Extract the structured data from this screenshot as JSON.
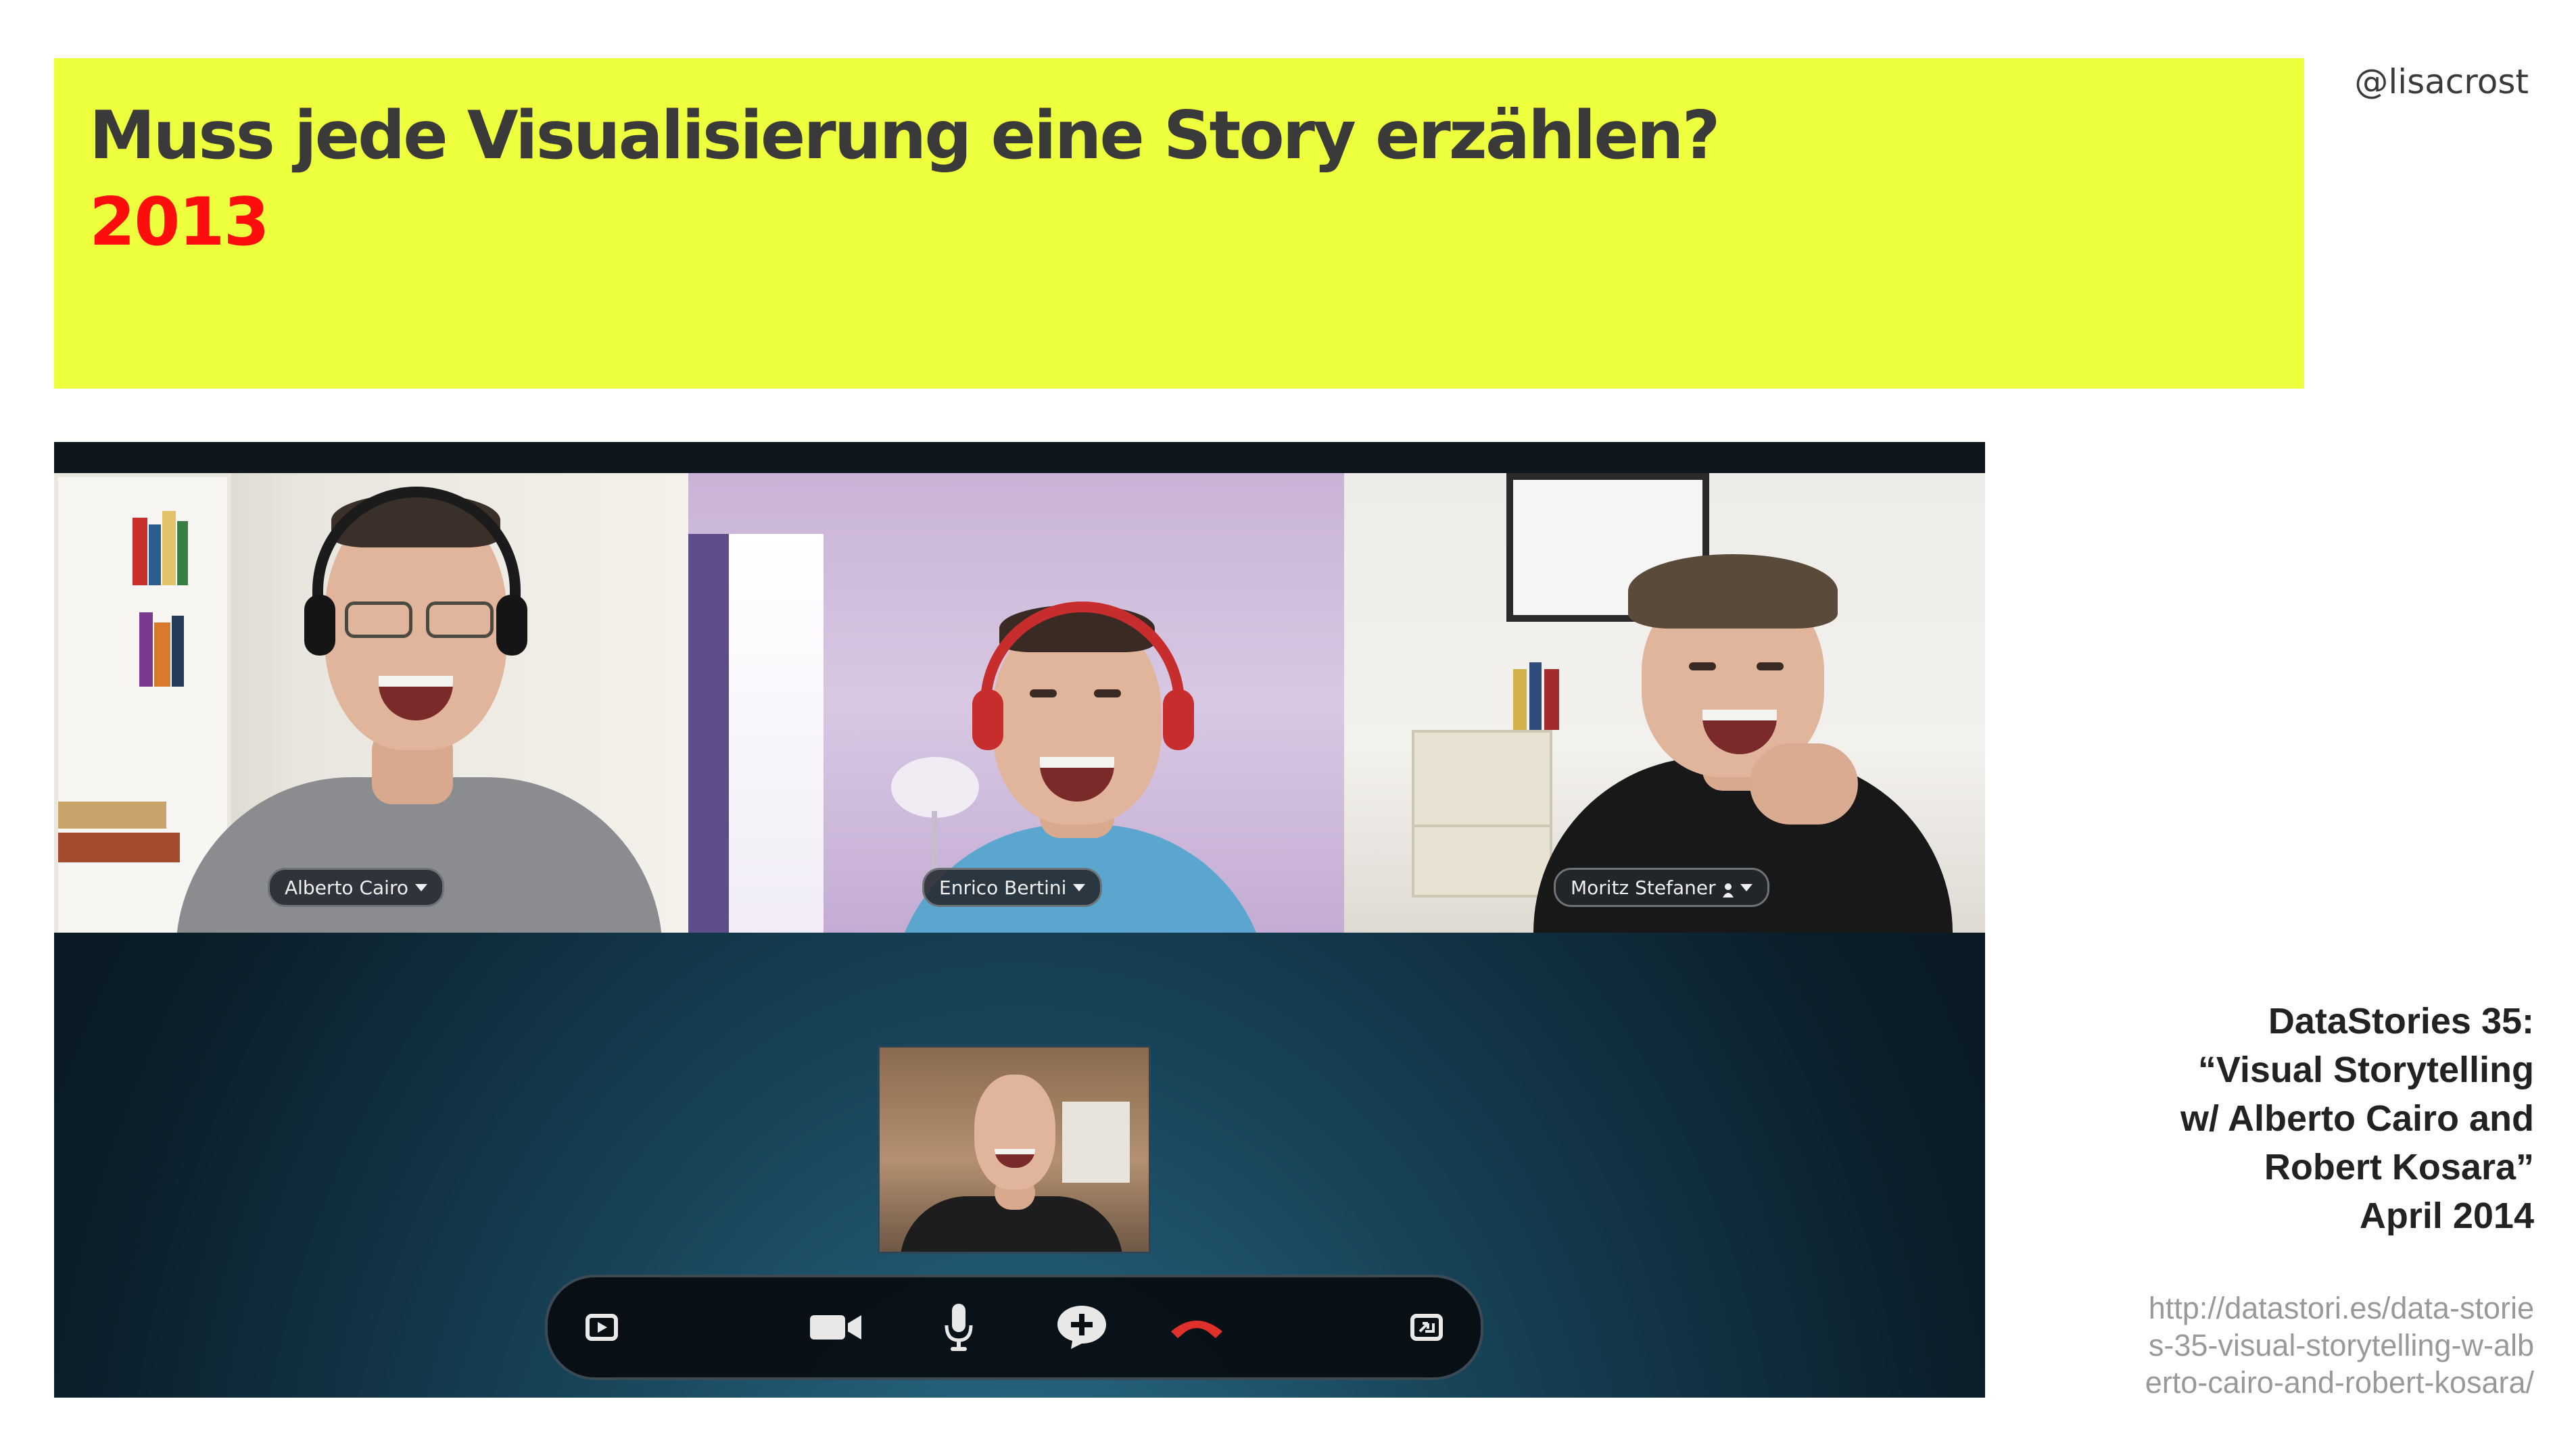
{
  "slide": {
    "title": "Muss jede Visualisierung eine Story erzählen?",
    "year": "2013",
    "handle": "@lisacrost",
    "title_box_color": "#eeff3e",
    "year_color": "#ff0d0d"
  },
  "video_call": {
    "participants": [
      {
        "name": "Alberto Cairo"
      },
      {
        "name": "Enrico Bertini"
      },
      {
        "name": "Moritz Stefaner"
      }
    ],
    "controls": [
      {
        "icon": "share-screen-icon"
      },
      {
        "icon": "video-camera-icon"
      },
      {
        "icon": "microphone-icon"
      },
      {
        "icon": "add-chat-icon"
      },
      {
        "icon": "hang-up-icon"
      },
      {
        "icon": "fullscreen-icon"
      }
    ],
    "hangup_color": "#e0302b"
  },
  "credit": {
    "lines": [
      "DataStories 35:",
      "“Visual Storytelling",
      "w/ Alberto Cairo and",
      "Robert Kosara”",
      "April 2014"
    ],
    "url_lines": [
      "http://datastori.es/data-storie",
      "s-35-visual-storytelling-w-alb",
      "erto-cairo-and-robert-kosara/"
    ]
  }
}
